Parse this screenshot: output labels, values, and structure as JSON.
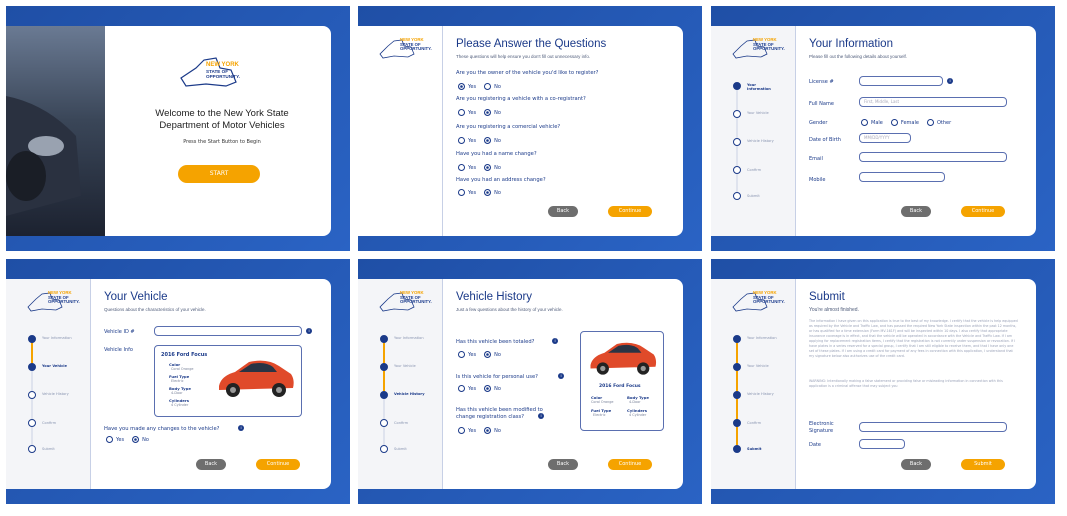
{
  "logo": {
    "line1": "NEW YORK",
    "line2": "STATE OF",
    "line3": "OPPORTUNITY."
  },
  "panel1": {
    "title_line1": "Welcome to the New York State",
    "title_line2": "Department of Motor Vehicles",
    "subtitle": "Press the Start Button to Begin",
    "start": "START"
  },
  "panel2": {
    "title": "Please Answer the Questions",
    "subtitle": "These questions will help ensure you don't fill out unnecessary info.",
    "questions": [
      {
        "q": "Are you the owner of the vehicle you'd like to register?"
      },
      {
        "q": "Are you registering a vehicle with a co-registrant?"
      },
      {
        "q": "Are you registering a comercial vehicle?"
      },
      {
        "q": "Have you had a name change?"
      },
      {
        "q": "Have you had an address change?"
      }
    ],
    "yes": "Yes",
    "no": "No",
    "back": "Back",
    "continue": "Continue"
  },
  "panel3": {
    "title": "Your Information",
    "subtitle": "Please fill out the following details about yourself.",
    "license": "License #",
    "full_name": "Full Name",
    "name_placeholder": "First, Middle, Last",
    "gender": "Gender",
    "male": "Male",
    "female": "Female",
    "other": "Other",
    "dob": "Date of Birth",
    "dob_placeholder": "MM/DD/YYYY",
    "email": "Email",
    "mobile": "Mobile",
    "back": "Back",
    "continue": "Continue"
  },
  "steps": [
    "Your Information",
    "Your Vehicle",
    "Vehicle History",
    "Confirm",
    "Submit"
  ],
  "panel4": {
    "title": "Your Vehicle",
    "subtitle": "Questions about the characteristics of your vehicle.",
    "vin": "Vehicle ID #",
    "info": "Vehicle Info",
    "car_name": "2016 Ford Focus",
    "color_lbl": "Color",
    "color_val": "Coral Orange",
    "fuel_lbl": "Fuel Type",
    "fuel_val": "Electric",
    "body_lbl": "Body Type",
    "body_val": "4-Door",
    "cyl_lbl": "Cylinders",
    "cyl_val": "4 Cylinder",
    "changes_q": "Have you made any changes to the vehicle?",
    "yes": "Yes",
    "no": "No",
    "back": "Back",
    "continue": "Continue"
  },
  "panel5": {
    "title": "Vehicle History",
    "subtitle": "Just a few questions about the history of your vehicle.",
    "q1": "Has this vehicle been totaled?",
    "q2": "Is this vehicle for personal use?",
    "q3a": "Has this vehicle been modified to",
    "q3b": "change registration class?",
    "car_name": "2016 Ford Focus",
    "yes": "Yes",
    "no": "No",
    "back": "Back",
    "continue": "Continue"
  },
  "panel6": {
    "title": "Submit",
    "subtitle": "You're almost finished.",
    "para1": "The information I have given on this application is true to the best of my knowledge. I certify that the vehicle is help equipped as required by the Vehicle and Traffic Law, and has passed the required New York State inspection within the past 12 months, or has qualified for a time extension (Form MV-161F) and will be inspected within 10 days. I also certify that appropriate insurance coverage is in effect, and that the vehicle will be operated in accordance with the Vehicle and Traffic Law. If I am applying for replacement registration items, I certify that the registration is not currently under suspension or revocation. If I have plates in a series reserved for a special group, I certify that I am still eligible to receive them, and that I have only one set of these plates. If I am using a credit card for payment of any fees in connection with this application, I understand that my signature below also authorizes use of the credit card.",
    "para2": "WARNING: Intentionally making a false statement or providing false or misleading information in connection with this application is a criminal offense that may subject you",
    "sig_lbl1": "Electronic",
    "sig_lbl2": "Signature",
    "date_lbl": "Date",
    "back": "Back",
    "submit": "Submit"
  }
}
